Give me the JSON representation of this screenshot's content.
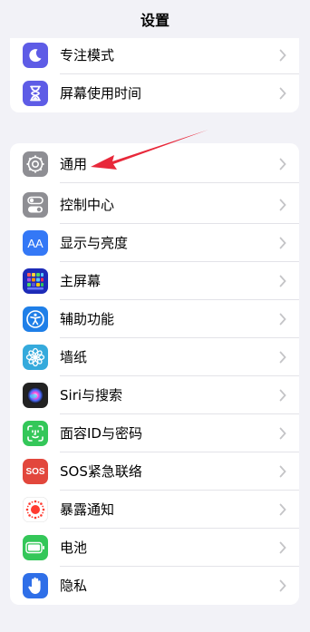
{
  "nav": {
    "title": "设置"
  },
  "top_group": [
    {
      "name": "row-focus",
      "label": "专注模式",
      "icon": "moon-icon",
      "color": "#5e5ce6"
    },
    {
      "name": "row-screen-time",
      "label": "屏幕使用时间",
      "icon": "hourglass-icon",
      "color": "#5e5ce6"
    }
  ],
  "main_group": [
    {
      "name": "row-general",
      "label": "通用",
      "icon": "gear-icon",
      "color": "#8e8e93"
    },
    {
      "name": "row-control-center",
      "label": "控制中心",
      "icon": "toggles-icon",
      "color": "#8e8e93"
    },
    {
      "name": "row-display",
      "label": "显示与亮度",
      "icon": "text-size-icon",
      "color": "#3478f6"
    },
    {
      "name": "row-home-screen",
      "label": "主屏幕",
      "icon": "app-grid-icon",
      "color": "#2c3fe0"
    },
    {
      "name": "row-accessibility",
      "label": "辅助功能",
      "icon": "accessibility-icon",
      "color": "#1f7fe8"
    },
    {
      "name": "row-wallpaper",
      "label": "墙纸",
      "icon": "flower-icon",
      "color": "#35aadc"
    },
    {
      "name": "row-siri",
      "label": "Siri与搜索",
      "icon": "siri-icon",
      "color": "#222222"
    },
    {
      "name": "row-face-id",
      "label": "面容ID与密码",
      "icon": "face-id-icon",
      "color": "#34c759"
    },
    {
      "name": "row-sos",
      "label": "SOS紧急联络",
      "icon": "sos-icon",
      "color": "#e2473c"
    },
    {
      "name": "row-exposure",
      "label": "暴露通知",
      "icon": "exposure-icon",
      "color": "#ffffff"
    },
    {
      "name": "row-battery",
      "label": "电池",
      "icon": "battery-icon",
      "color": "#34c759"
    },
    {
      "name": "row-privacy",
      "label": "隐私",
      "icon": "hand-icon",
      "color": "#2f6fe8"
    }
  ],
  "sos_icon_text": "SOS",
  "display_icon_text": "AA",
  "annotation_color": "#e8283a"
}
